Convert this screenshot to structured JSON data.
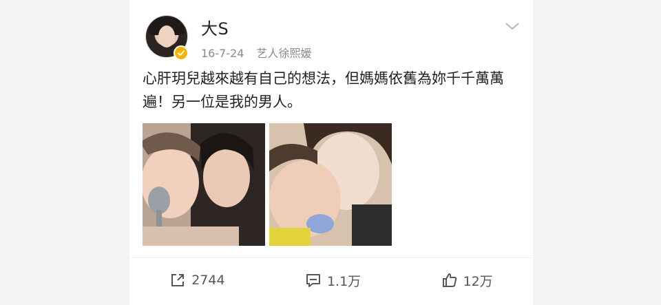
{
  "post": {
    "author": "大S",
    "date": "16-7-24",
    "source": "艺人徐熙媛",
    "text": "心肝玥兒越來越有自己的想法，但媽媽依舊為妳千千萬萬遍！另一位是我的男人。"
  },
  "icons": {
    "verified": "verified-badge-icon",
    "more": "chevron-down-icon",
    "repost": "share-icon",
    "comment": "comment-icon",
    "like": "thumbs-up-icon"
  },
  "stats": {
    "reposts": "2744",
    "comments": "1.1万",
    "likes": "12万"
  },
  "colors": {
    "verified": "#f5b400",
    "meta_text": "#8a8a8a",
    "background": "#f3f3f5"
  }
}
